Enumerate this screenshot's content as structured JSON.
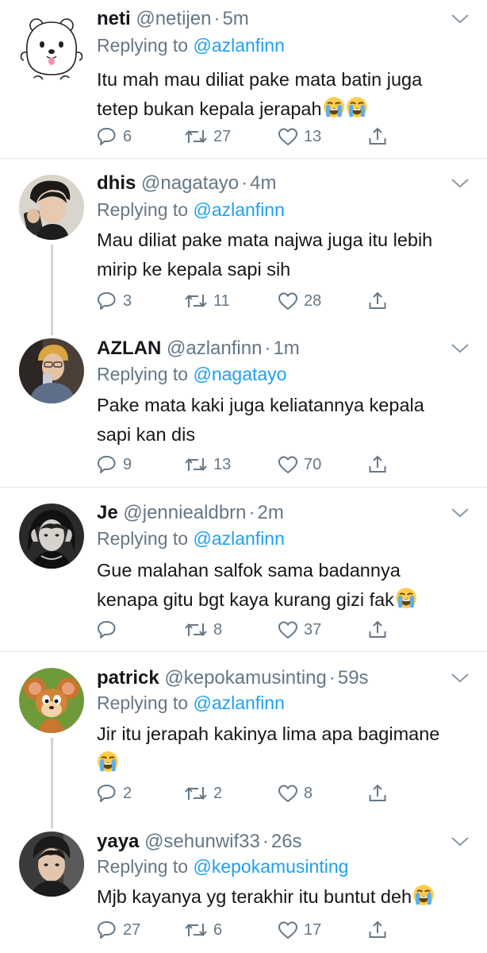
{
  "colors": {
    "link": "#1da1f2",
    "secondary": "#657786",
    "text": "#14171a",
    "divider": "#e1e8ed"
  },
  "tweets": [
    {
      "name": "neti",
      "handle": "@netijen",
      "time": "5m",
      "replying_label": "Replying to",
      "replying_to": "@azlanfinn",
      "lines": [
        "Itu mah mau diliat pake mata batin juga",
        "tetep bukan kepala jerapah"
      ],
      "replies": "6",
      "retweets": "27",
      "likes": "13",
      "avatar": "polar-bear-cartoon"
    },
    {
      "name": "dhis",
      "handle": "@nagatayo",
      "time": "4m",
      "replying_label": "Replying to",
      "replying_to": "@azlanfinn",
      "lines": [
        "Mau diliat pake mata najwa juga itu lebih",
        "mirip ke kepala sapi sih"
      ],
      "replies": "3",
      "retweets": "11",
      "likes": "28",
      "avatar": "person-photo"
    },
    {
      "name": "AZLAN",
      "handle": "@azlanfinn",
      "time": "1m",
      "replying_label": "Replying to",
      "replying_to": "@nagatayo",
      "lines": [
        "Pake mata kaki juga keliatannya kepala",
        "sapi kan dis"
      ],
      "replies": "9",
      "retweets": "13",
      "likes": "70",
      "avatar": "person-mirror-selfie"
    },
    {
      "name": "Je",
      "handle": "@jenniealdbrn",
      "time": "2m",
      "replying_label": "Replying to",
      "replying_to": "@azlanfinn",
      "lines": [
        "Gue malahan salfok sama badannya",
        "kenapa gitu bgt kaya kurang gizi fak"
      ],
      "replies": "",
      "retweets": "8",
      "likes": "37",
      "avatar": "person-bw-photo"
    },
    {
      "name": "patrick",
      "handle": "@kepokamusinting",
      "time": "59s",
      "replying_label": "Replying to",
      "replying_to": "@azlanfinn",
      "lines": [
        "Jir itu jerapah kakinya lima apa bagimane",
        ""
      ],
      "replies": "2",
      "retweets": "2",
      "likes": "8",
      "avatar": "cartoon-mouse"
    },
    {
      "name": "yaya",
      "handle": "@sehunwif33",
      "time": "26s",
      "replying_label": "Replying to",
      "replying_to": "@kepokamusinting",
      "lines": [
        "Mjb kayanya yg terakhir itu buntut deh"
      ],
      "replies": "27",
      "retweets": "6",
      "likes": "17",
      "avatar": "person-portrait"
    }
  ]
}
